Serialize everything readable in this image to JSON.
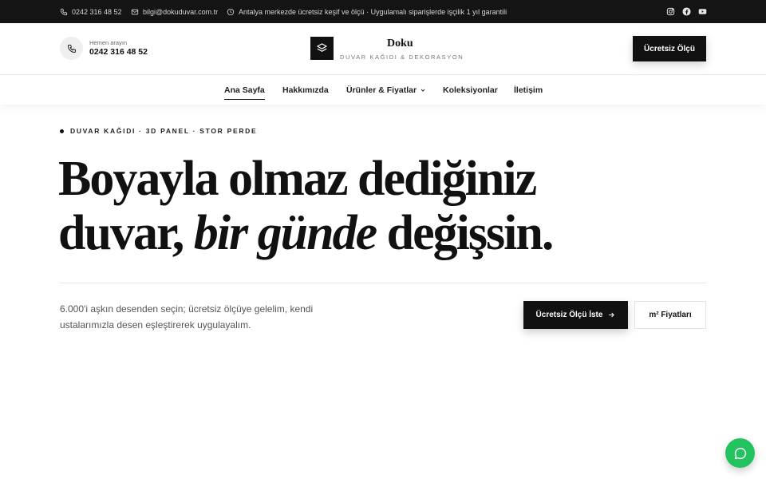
{
  "topbar": {
    "phone": "0242 316 48 52",
    "email": "bilgi@dokuduvar.com.tr",
    "notice": "Antalya merkezde ücretsiz keşif ve ölçü · Uygulamalı siparişlerde işçilik 1 yıl garantili",
    "social": [
      "instagram-icon",
      "facebook-icon",
      "youtube-icon"
    ]
  },
  "header": {
    "call_hint": "Hemen arayın",
    "call_number": "0242 316 48 52",
    "brand_name": "Doku",
    "brand_tagline": "DUVAR KAĞIDI & DEKORASYON",
    "cta_label": "Ücretsiz Ölçü"
  },
  "nav": {
    "items": [
      {
        "label": "Ana Sayfa",
        "active": true
      },
      {
        "label": "Hakkımızda"
      },
      {
        "label": "Ürünler & Fiyatlar",
        "has_dropdown": true
      },
      {
        "label": "Koleksiyonlar"
      },
      {
        "label": "İletişim"
      }
    ]
  },
  "hero": {
    "eyebrow": "DUVAR KAĞIDI · 3D PANEL · STOR PERDE",
    "headline_line1": "Boyayla olmaz dediğiniz",
    "headline_line2_start": "duvar, ",
    "headline_line2_italic": "bir günde",
    "headline_line2_end": " değişsin.",
    "description": "6.000'i aşkın desenden seçin; ücretsiz ölçüye gelelim, kendi ustalarımızla desen eşleştirerek uygulayalım.",
    "primary_cta": "Ücretsiz Ölçü İste",
    "secondary_cta": "m² Fiyatları"
  },
  "colors": {
    "topbar_bg": "#141414",
    "primary": "#111111",
    "chat_green": "#22c35e"
  }
}
